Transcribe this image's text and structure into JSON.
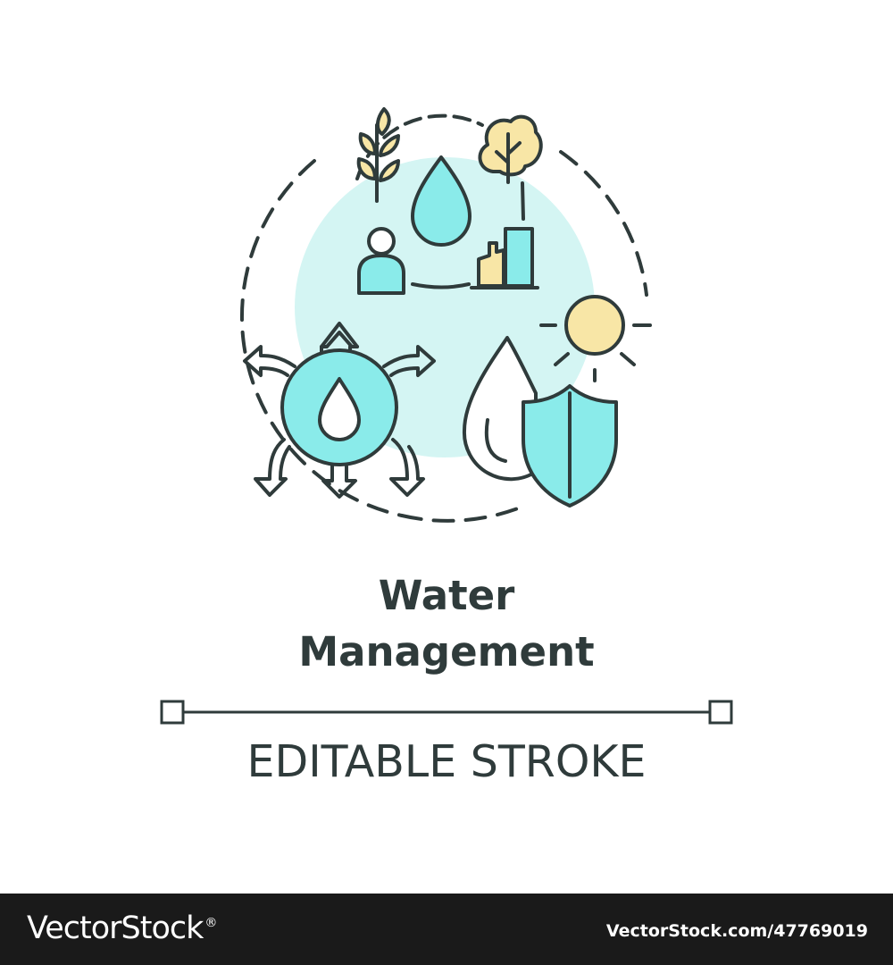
{
  "title": {
    "line1": "Water",
    "line2": "Management"
  },
  "subtitle": "EDITABLE STROKE",
  "footer": {
    "logo_text": "VectorStock",
    "logo_mark": "®",
    "url": "VectorStock.com/47769019"
  },
  "colors": {
    "outline": "#2f3b3b",
    "aqua": "#8aebea",
    "aqua_light": "#d4f5f3",
    "yellow": "#f8e6a6",
    "footer_bg": "#1a1a1a"
  },
  "icons": [
    "wheat-icon",
    "tree-icon",
    "water-drop-icon",
    "person-icon",
    "bar-chart-icon",
    "distribution-drop-icon",
    "sun-icon",
    "water-shield-icon"
  ]
}
